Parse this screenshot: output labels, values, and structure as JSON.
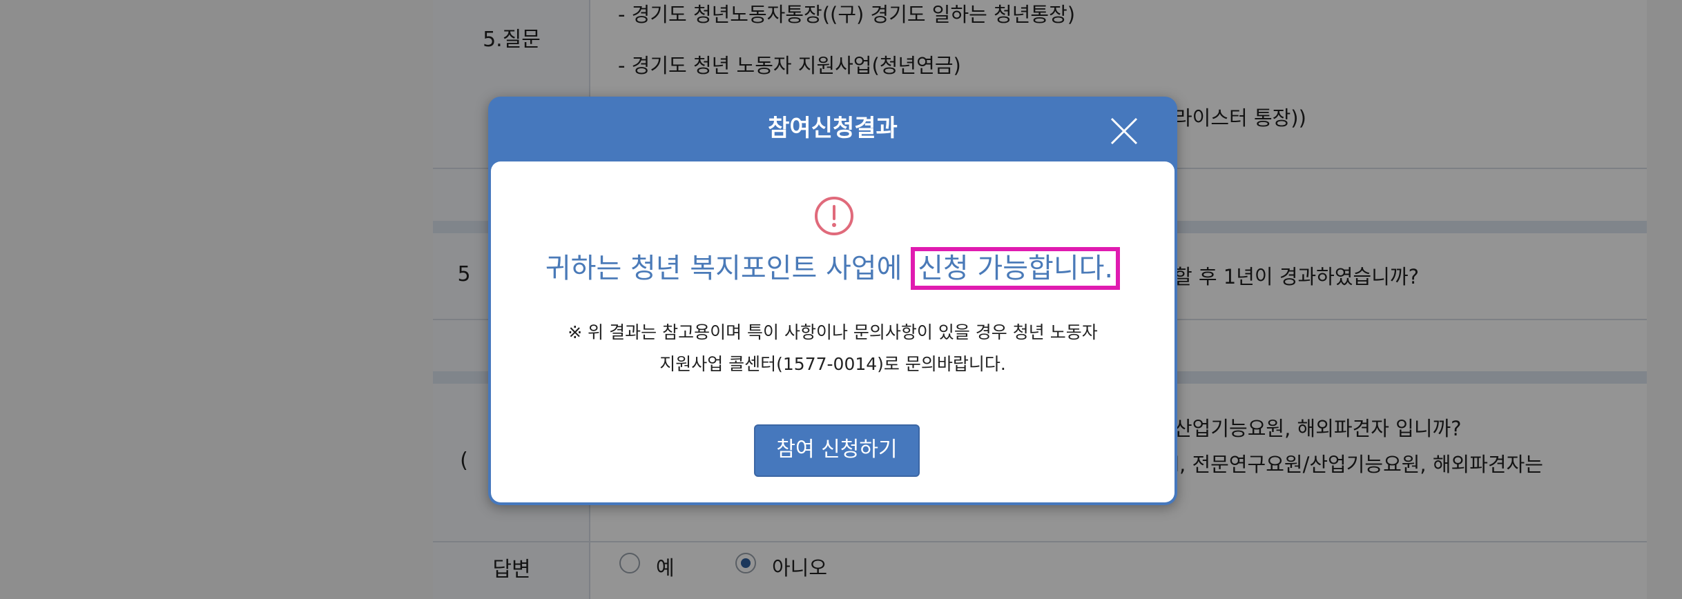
{
  "background_form": {
    "q5_label": "5.질문",
    "q5_line1": "- 경기도 청년노동자통장((구) 경기도 일하는 청년통장)",
    "q5_line2": "- 경기도 청년 노동자 지원사업(청년연금)",
    "q5_line3": "라이스터 통장))",
    "row2_label": "5",
    "row2_text": "할 후 1년이 경과하였습니까?",
    "row3_label": "(",
    "row3_line1": "산업기능요원, 해외파견자 입니까?",
    "row3_line2": "l, 전문연구요원/산업기능요원, 해외파견자는",
    "answer_label": "답변",
    "option_yes": "예",
    "option_no": "아니오",
    "selected_option": "아니오"
  },
  "modal": {
    "title": "참여신청결과",
    "headline_prefix": "귀하는 청년 복지포인트 사업에 ",
    "headline_highlight": "신청 가능합니다.",
    "note_line1": "※ 위 결과는 참고용이며 특이 사항이나 문의사항이 있을 경우 청년 노동자",
    "note_line2": "지원사업 콜센터(1577-0014)로 문의바랍니다.",
    "button_label": "참여 신청하기",
    "icons": {
      "status": "exclamation-circle-icon",
      "close": "close-icon"
    }
  },
  "colors": {
    "modal_header": "#4678bd",
    "headline_text": "#4a7ab8",
    "highlight_border": "#e01bb0",
    "warning_icon": "#e06a7b"
  }
}
